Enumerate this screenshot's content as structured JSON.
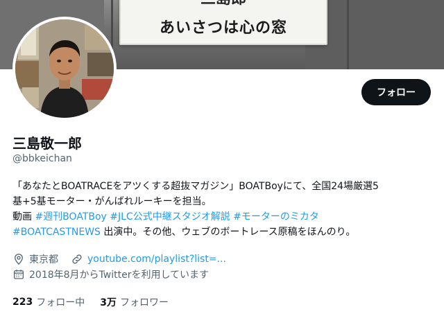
{
  "banner": {
    "sign_top": "三島郎",
    "sign_main": "あいさつは心の窓"
  },
  "profile": {
    "display_name": "三島敬一郎",
    "handle": "@bbkeichan",
    "follow_label": "フォロー",
    "bio": {
      "line1": "「あなたとBOATRACEをアツくする超抜マガジン」BOATBoyにて、全国24場厳選5",
      "line2": "基+5基モーター・がんばれルーキーを担当。",
      "line3_prefix": "動画 ",
      "tag1": "#週刊BOATBoy",
      "tag2": "#JLC公式中継スタジオ解説",
      "tag3": "#モーターのミカタ",
      "tag4": "#BOATCASTNEWS",
      "line4_suffix": " 出演中。その他、ウェブのボートレース原稿をほんのり。"
    },
    "location": "東京都",
    "link": "youtube.com/playlist?list=...",
    "joined": "2018年8月からTwitterを利用しています",
    "following_count": "223",
    "following_label": "フォロー中",
    "followers_count": "3万",
    "followers_label": "フォロワー"
  },
  "colors": {
    "accent": "#1d9bf0",
    "secondary_text": "#536471",
    "primary_text": "#0f1419"
  },
  "icons": [
    "location-pin-icon",
    "link-icon",
    "calendar-icon"
  ]
}
